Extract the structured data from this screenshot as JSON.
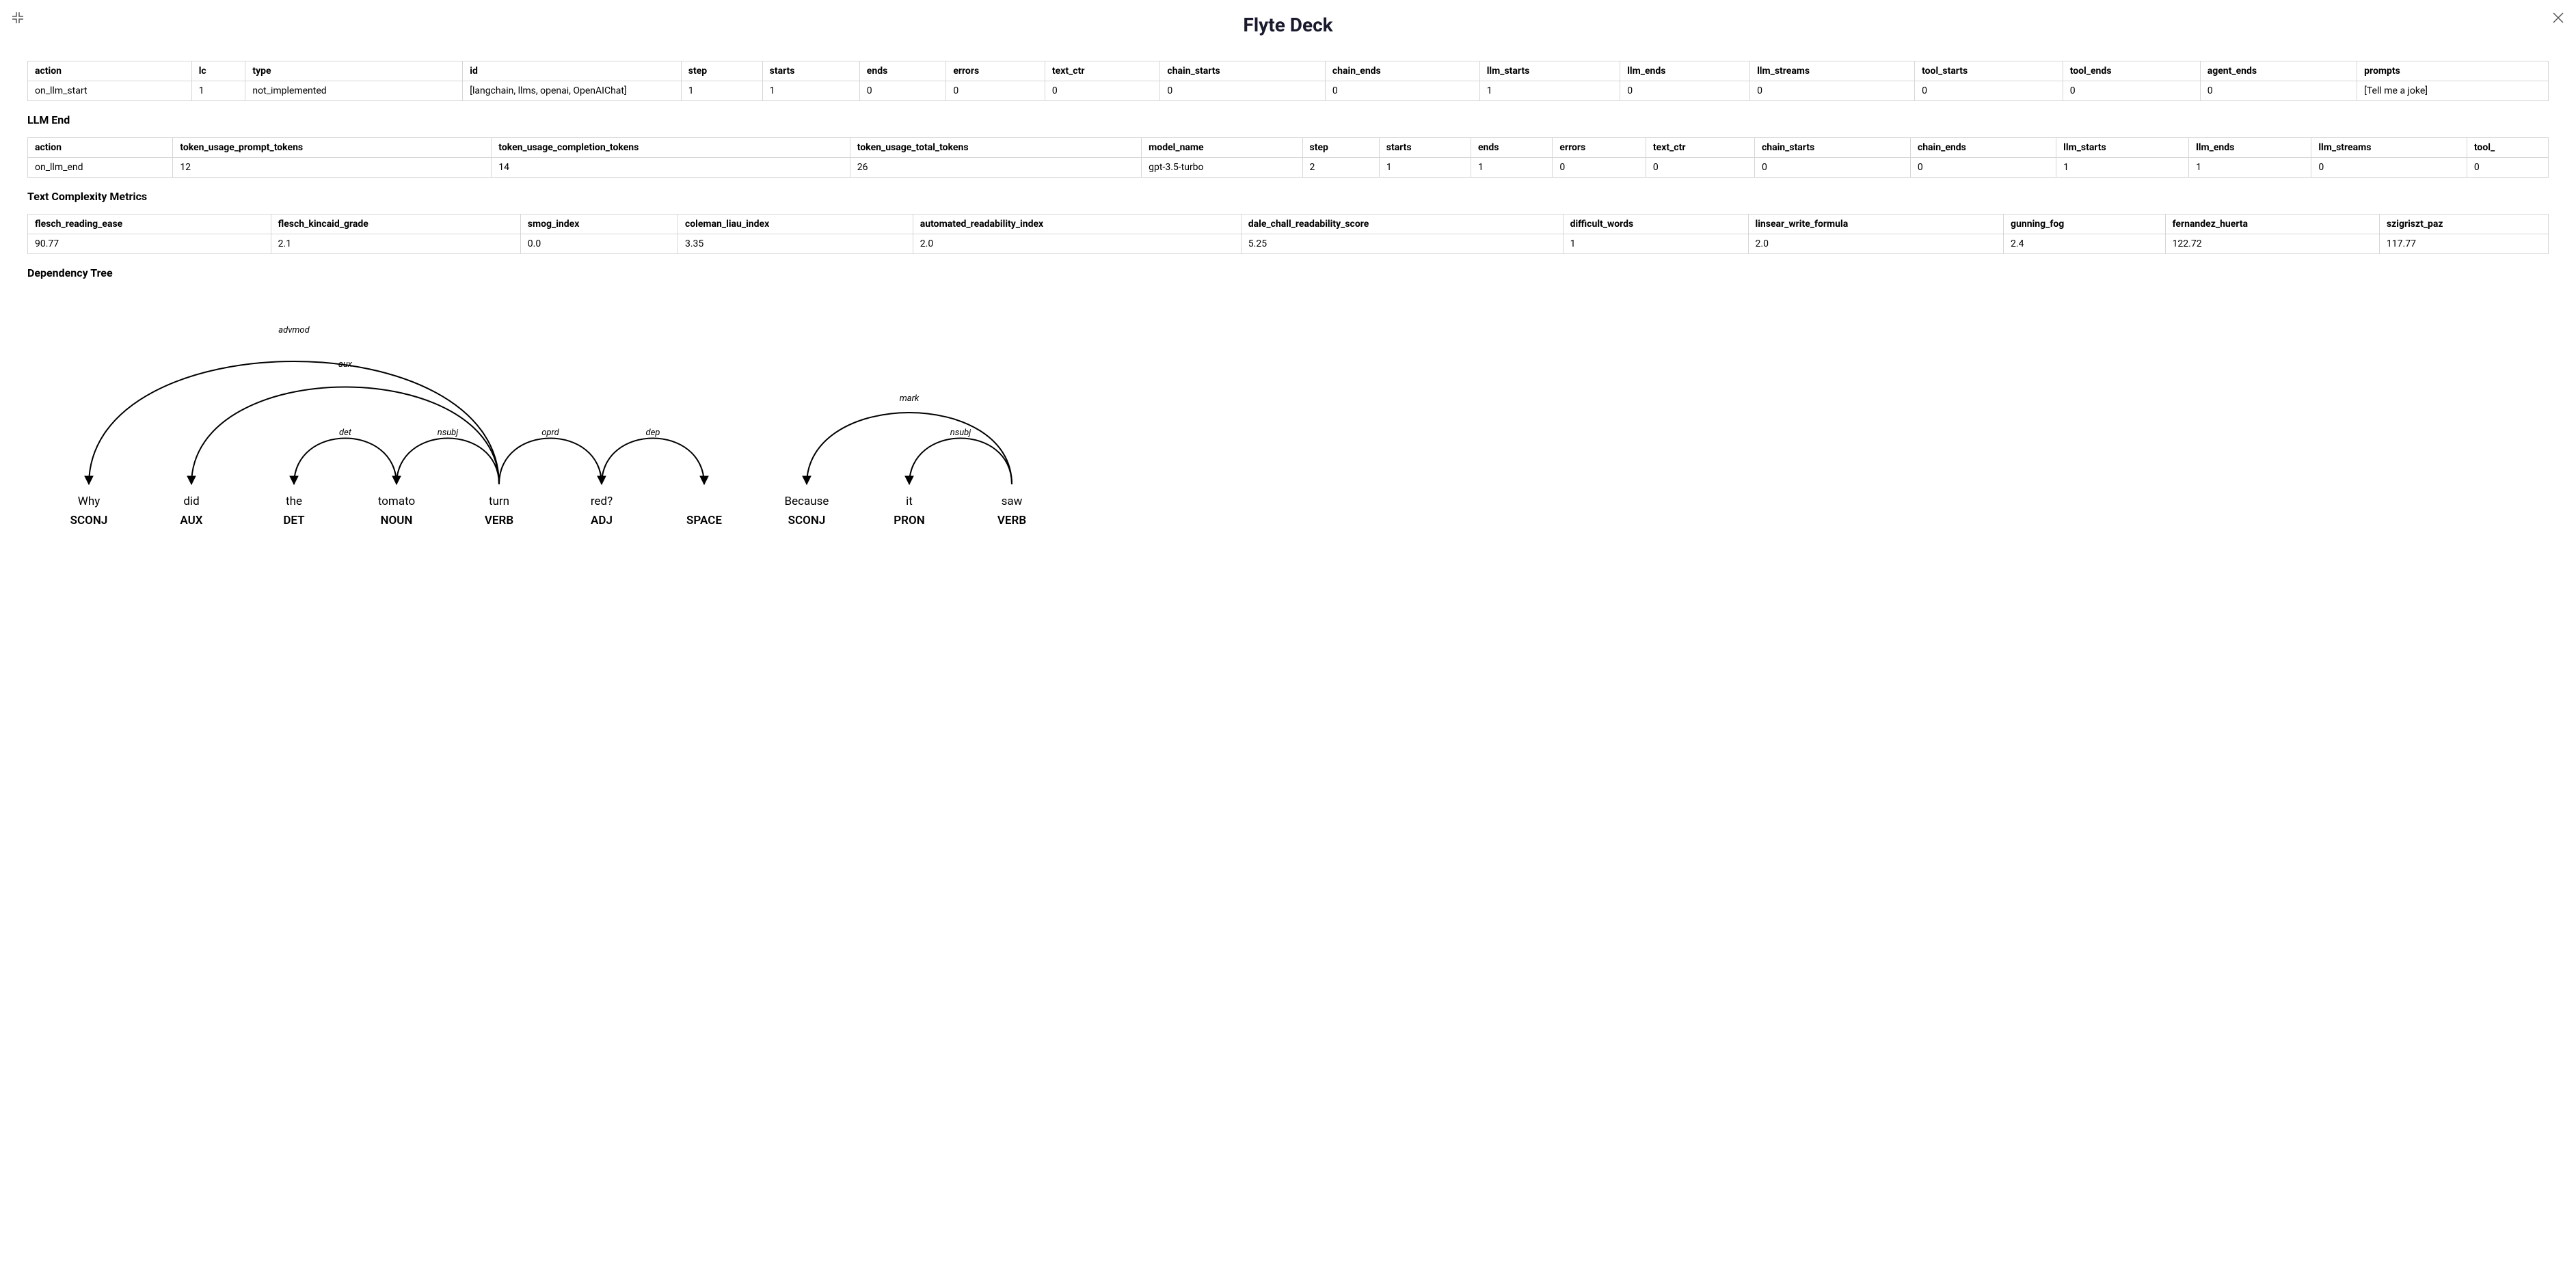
{
  "title": "Flyte Deck",
  "sections": {
    "llm_end": "LLM End",
    "text_complexity": "Text Complexity Metrics",
    "dep_tree": "Dependency Tree"
  },
  "tables": {
    "llm_start": {
      "headers": [
        "action",
        "lc",
        "type",
        "id",
        "step",
        "starts",
        "ends",
        "errors",
        "text_ctr",
        "chain_starts",
        "chain_ends",
        "llm_starts",
        "llm_ends",
        "llm_streams",
        "tool_starts",
        "tool_ends",
        "agent_ends",
        "prompts"
      ],
      "rows": [
        [
          "on_llm_start",
          "1",
          "not_implemented",
          "[langchain, llms, openai, OpenAIChat]",
          "1",
          "1",
          "0",
          "0",
          "0",
          "0",
          "0",
          "1",
          "0",
          "0",
          "0",
          "0",
          "0",
          "[Tell me a joke]"
        ]
      ]
    },
    "llm_end": {
      "headers": [
        "action",
        "token_usage_prompt_tokens",
        "token_usage_completion_tokens",
        "token_usage_total_tokens",
        "model_name",
        "step",
        "starts",
        "ends",
        "errors",
        "text_ctr",
        "chain_starts",
        "chain_ends",
        "llm_starts",
        "llm_ends",
        "llm_streams",
        "tool_"
      ],
      "rows": [
        [
          "on_llm_end",
          "12",
          "14",
          "26",
          "gpt-3.5-turbo",
          "2",
          "1",
          "1",
          "0",
          "0",
          "0",
          "0",
          "1",
          "1",
          "0",
          "0"
        ]
      ]
    },
    "text_complexity": {
      "headers": [
        "flesch_reading_ease",
        "flesch_kincaid_grade",
        "smog_index",
        "coleman_liau_index",
        "automated_readability_index",
        "dale_chall_readability_score",
        "difficult_words",
        "linsear_write_formula",
        "gunning_fog",
        "fernandez_huerta",
        "szigriszt_paz"
      ],
      "rows": [
        [
          "90.77",
          "2.1",
          "0.0",
          "3.35",
          "2.0",
          "5.25",
          "1",
          "2.0",
          "2.4",
          "122.72",
          "117.77"
        ]
      ]
    }
  },
  "dep_tree": {
    "tokens": [
      {
        "word": "Why",
        "pos": "SCONJ"
      },
      {
        "word": "did",
        "pos": "AUX"
      },
      {
        "word": "the",
        "pos": "DET"
      },
      {
        "word": "tomato",
        "pos": "NOUN"
      },
      {
        "word": "turn",
        "pos": "VERB"
      },
      {
        "word": "red?",
        "pos": "ADJ"
      },
      {
        "word": "",
        "pos": "SPACE"
      },
      {
        "word": "Because",
        "pos": "SCONJ"
      },
      {
        "word": "it",
        "pos": "PRON"
      },
      {
        "word": "saw",
        "pos": "VERB"
      }
    ],
    "arcs": [
      {
        "label": "advmod",
        "head": 4,
        "dep": 0
      },
      {
        "label": "aux",
        "head": 4,
        "dep": 1
      },
      {
        "label": "det",
        "head": 3,
        "dep": 2
      },
      {
        "label": "nsubj",
        "head": 4,
        "dep": 3
      },
      {
        "label": "oprd",
        "head": 4,
        "dep": 5
      },
      {
        "label": "dep",
        "head": 5,
        "dep": 6
      },
      {
        "label": "mark",
        "head": 9,
        "dep": 7
      },
      {
        "label": "nsubj",
        "head": 9,
        "dep": 8
      }
    ]
  }
}
